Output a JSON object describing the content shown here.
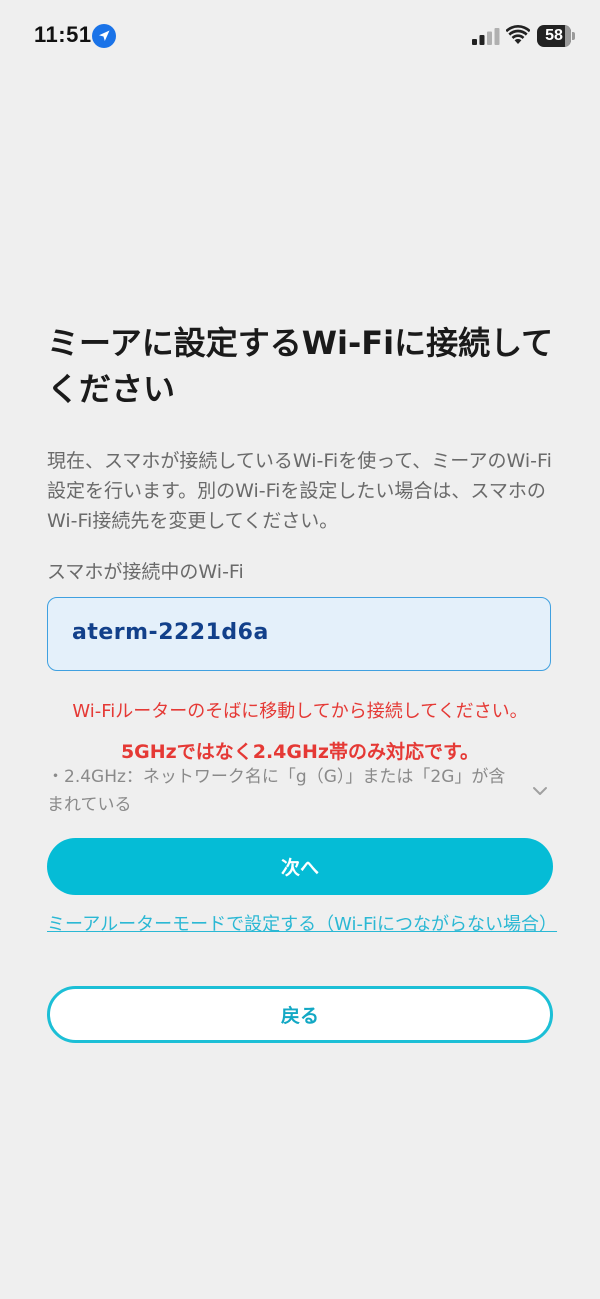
{
  "status_bar": {
    "time": "11:51",
    "battery_level": "58",
    "icons": [
      "location-arrow-icon",
      "cellular-signal-icon",
      "wifi-icon",
      "battery-icon"
    ]
  },
  "page": {
    "title": "ミーアに設定するWi-Fiに接続してください",
    "description": "現在、スマホが接続しているWi-Fiを使って、ミーアのWi-Fi設定を行います。別のWi-Fiを設定したい場合は、スマホのWi-Fi接続先を変更してください。",
    "field_label": "スマホが接続中のWi-Fi",
    "ssid_value": "aterm-2221d6a",
    "warning": "Wi-Fiルーターのそばに移動してから接続してください。",
    "band_note": "5GHzではなく2.4GHz帯のみ対応です。",
    "band_detail": "・2.4GHz：ネットワーク名に「g（G）」または「2G」が含まれている",
    "expand_icon": "chevron-down-icon"
  },
  "actions": {
    "next_label": "次へ",
    "router_mode_link": "ミーアルーターモードで設定する（Wi-Fiにつながらない場合）",
    "back_label": "戻る"
  },
  "colors": {
    "background": "#efefef",
    "accent": "#05bcd6",
    "warning": "#e53935",
    "field_bg": "#e4f0fa",
    "field_border": "#3fa0e0"
  }
}
